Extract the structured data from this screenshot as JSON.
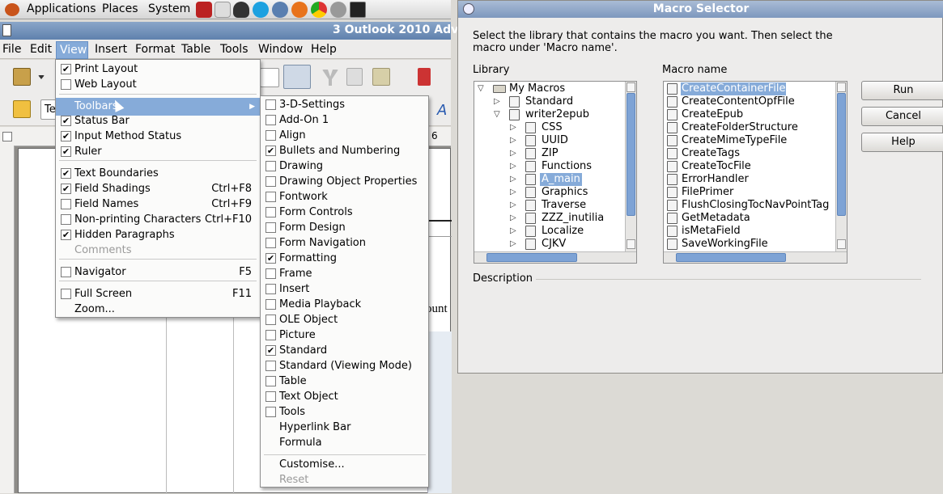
{
  "panel": {
    "applications": "Applications",
    "places": "Places",
    "system": "System"
  },
  "writer": {
    "title": "3 Outlook 2010 Adv",
    "menus": [
      "File",
      "Edit",
      "View",
      "Insert",
      "Format",
      "Table",
      "Tools",
      "Window",
      "Help"
    ],
    "style_box": "Te",
    "ruler_text": "6",
    "doc_text": "ount"
  },
  "view_menu": {
    "items": [
      {
        "label": "Print Layout",
        "checked": true
      },
      {
        "label": "Web Layout",
        "checked": false
      },
      {
        "label": "Toolbars",
        "submenu": true
      },
      {
        "label": "Status Bar",
        "checked": true
      },
      {
        "label": "Input Method Status",
        "checked": true
      },
      {
        "label": "Ruler",
        "checked": true
      },
      {
        "label": "Text Boundaries",
        "checked": true
      },
      {
        "label": "Field Shadings",
        "checked": true,
        "shortcut": "Ctrl+F8"
      },
      {
        "label": "Field Names",
        "checked": false,
        "shortcut": "Ctrl+F9"
      },
      {
        "label": "Non-printing Characters",
        "checked": false,
        "shortcut": "Ctrl+F10"
      },
      {
        "label": "Hidden Paragraphs",
        "checked": true
      },
      {
        "label": "Comments",
        "disabled": true
      },
      {
        "label": "Navigator",
        "checked": false,
        "shortcut": "F5"
      },
      {
        "label": "Full Screen",
        "checked": false,
        "shortcut": "F11"
      },
      {
        "label": "Zoom..."
      }
    ]
  },
  "toolbars_menu": {
    "items": [
      {
        "label": "3-D-Settings",
        "checked": false
      },
      {
        "label": "Add-On 1",
        "checked": false
      },
      {
        "label": "Align",
        "checked": false
      },
      {
        "label": "Bullets and Numbering",
        "checked": true
      },
      {
        "label": "Drawing",
        "checked": false
      },
      {
        "label": "Drawing Object Properties",
        "checked": false
      },
      {
        "label": "Fontwork",
        "checked": false
      },
      {
        "label": "Form Controls",
        "checked": false
      },
      {
        "label": "Form Design",
        "checked": false
      },
      {
        "label": "Form Navigation",
        "checked": false
      },
      {
        "label": "Formatting",
        "checked": true
      },
      {
        "label": "Frame",
        "checked": false
      },
      {
        "label": "Insert",
        "checked": false
      },
      {
        "label": "Media Playback",
        "checked": false
      },
      {
        "label": "OLE Object",
        "checked": false
      },
      {
        "label": "Picture",
        "checked": false
      },
      {
        "label": "Standard",
        "checked": true
      },
      {
        "label": "Standard (Viewing Mode)",
        "checked": false
      },
      {
        "label": "Table",
        "checked": false
      },
      {
        "label": "Text Object",
        "checked": false
      },
      {
        "label": "Tools",
        "checked": false
      },
      {
        "label": "Hyperlink Bar"
      },
      {
        "label": "Formula"
      },
      {
        "label": "Customise..."
      },
      {
        "label": "Reset",
        "disabled": true
      }
    ]
  },
  "dialog": {
    "title": "Macro Selector",
    "instructions": "Select the library that contains the macro you want. Then select the macro under 'Macro name'.",
    "library_label": "Library",
    "macro_label": "Macro name",
    "description_label": "Description",
    "library_tree": [
      {
        "label": "My Macros",
        "level": 0,
        "expanded": true,
        "type": "folder"
      },
      {
        "label": "Standard",
        "level": 1,
        "expanded": false,
        "type": "lib"
      },
      {
        "label": "writer2epub",
        "level": 1,
        "expanded": true,
        "type": "lib"
      },
      {
        "label": "CSS",
        "level": 2,
        "type": "module"
      },
      {
        "label": "UUID",
        "level": 2,
        "type": "module"
      },
      {
        "label": "ZIP",
        "level": 2,
        "type": "module"
      },
      {
        "label": "Functions",
        "level": 2,
        "type": "module"
      },
      {
        "label": "A_main",
        "level": 2,
        "type": "module",
        "selected": true
      },
      {
        "label": "Graphics",
        "level": 2,
        "type": "module"
      },
      {
        "label": "Traverse",
        "level": 2,
        "type": "module"
      },
      {
        "label": "ZZZ_inutilia",
        "level": 2,
        "type": "module"
      },
      {
        "label": "Localize",
        "level": 2,
        "type": "module"
      },
      {
        "label": "CJKV",
        "level": 2,
        "type": "module"
      }
    ],
    "macros": [
      "CreateContainerFile",
      "CreateContentOpfFile",
      "CreateEpub",
      "CreateFolderStructure",
      "CreateMimeTypeFile",
      "CreateTags",
      "CreateTocFile",
      "ErrorHandler",
      "FilePrimer",
      "FlushClosingTocNavPointTag",
      "GetMetadata",
      "isMetaField",
      "SaveWorkingFile"
    ],
    "selected_macro": "CreateContainerFile",
    "buttons": {
      "run": "Run",
      "cancel": "Cancel",
      "help": "Help"
    }
  }
}
